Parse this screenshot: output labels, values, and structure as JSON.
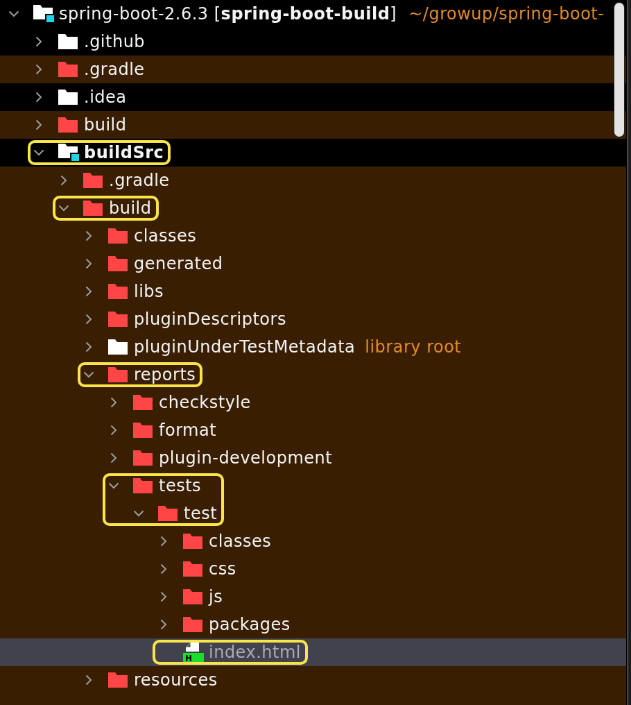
{
  "project": {
    "kind": "project",
    "name": "spring-boot-2.6.3 [**spring-boot-build**]",
    "path": "~/growup/spring-boot-",
    "color": "#ffffff",
    "expanded": true,
    "tinted": false,
    "selected": false,
    "highlighted": false,
    "children": [
      {
        "kind": "folder",
        "name": ".github",
        "color": "#ffffff",
        "expanded": false,
        "tinted": false,
        "selected": false,
        "highlighted": false
      },
      {
        "kind": "folder",
        "name": ".gradle",
        "color": "#ff4545",
        "expanded": false,
        "tinted": true,
        "selected": false,
        "highlighted": false
      },
      {
        "kind": "folder",
        "name": ".idea",
        "color": "#ffffff",
        "expanded": false,
        "tinted": false,
        "selected": false,
        "highlighted": false
      },
      {
        "kind": "folder",
        "name": "build",
        "color": "#ff4545",
        "expanded": false,
        "tinted": true,
        "selected": false,
        "highlighted": false
      },
      {
        "kind": "module",
        "name": "buildSrc",
        "color": "#ffffff",
        "expanded": true,
        "tinted": false,
        "selected": false,
        "highlighted": true,
        "children": [
          {
            "kind": "folder",
            "name": ".gradle",
            "color": "#ff4545",
            "expanded": false,
            "tinted": true,
            "selected": false,
            "highlighted": false
          },
          {
            "kind": "folder",
            "name": "build",
            "color": "#ff4545",
            "expanded": true,
            "tinted": true,
            "selected": false,
            "highlighted": true,
            "children": [
              {
                "kind": "folder",
                "name": "classes",
                "color": "#ff4545",
                "expanded": false,
                "tinted": true,
                "selected": false,
                "highlighted": false
              },
              {
                "kind": "folder",
                "name": "generated",
                "color": "#ff4545",
                "expanded": false,
                "tinted": true,
                "selected": false,
                "highlighted": false
              },
              {
                "kind": "folder",
                "name": "libs",
                "color": "#ff4545",
                "expanded": false,
                "tinted": true,
                "selected": false,
                "highlighted": false
              },
              {
                "kind": "folder",
                "name": "pluginDescriptors",
                "color": "#ff4545",
                "expanded": false,
                "tinted": true,
                "selected": false,
                "highlighted": false
              },
              {
                "kind": "folder",
                "name": "pluginUnderTestMetadata",
                "note": "library root",
                "color": "#ffffff",
                "expanded": false,
                "tinted": true,
                "selected": false,
                "highlighted": false
              },
              {
                "kind": "folder",
                "name": "reports",
                "color": "#ff4545",
                "expanded": true,
                "tinted": true,
                "selected": false,
                "highlighted": true,
                "children": [
                  {
                    "kind": "folder",
                    "name": "checkstyle",
                    "color": "#ff4545",
                    "expanded": false,
                    "tinted": true,
                    "selected": false,
                    "highlighted": false
                  },
                  {
                    "kind": "folder",
                    "name": "format",
                    "color": "#ff4545",
                    "expanded": false,
                    "tinted": true,
                    "selected": false,
                    "highlighted": false
                  },
                  {
                    "kind": "folder",
                    "name": "plugin-development",
                    "color": "#ff4545",
                    "expanded": false,
                    "tinted": true,
                    "selected": false,
                    "highlighted": false
                  },
                  {
                    "kind": "folder",
                    "name": "tests",
                    "color": "#ff4545",
                    "expanded": true,
                    "tinted": true,
                    "selected": false,
                    "highlighted": true,
                    "children": [
                      {
                        "kind": "folder",
                        "name": "test",
                        "color": "#ff4545",
                        "expanded": true,
                        "tinted": true,
                        "selected": false,
                        "highlighted": true,
                        "children": [
                          {
                            "kind": "folder",
                            "name": "classes",
                            "color": "#ff4545",
                            "expanded": false,
                            "tinted": true,
                            "selected": false,
                            "highlighted": false
                          },
                          {
                            "kind": "folder",
                            "name": "css",
                            "color": "#ff4545",
                            "expanded": false,
                            "tinted": true,
                            "selected": false,
                            "highlighted": false
                          },
                          {
                            "kind": "folder",
                            "name": "js",
                            "color": "#ff4545",
                            "expanded": false,
                            "tinted": true,
                            "selected": false,
                            "highlighted": false
                          },
                          {
                            "kind": "folder",
                            "name": "packages",
                            "color": "#ff4545",
                            "expanded": false,
                            "tinted": true,
                            "selected": false,
                            "highlighted": false
                          },
                          {
                            "kind": "file",
                            "name": "index.html",
                            "badge": "H",
                            "selected": true,
                            "highlighted": true
                          }
                        ]
                      }
                    ]
                  }
                ]
              },
              {
                "kind": "folder",
                "name": "resources",
                "color": "#ff4545",
                "expanded": false,
                "tinted": true,
                "selected": false,
                "highlighted": false
              }
            ]
          }
        ]
      }
    ]
  }
}
